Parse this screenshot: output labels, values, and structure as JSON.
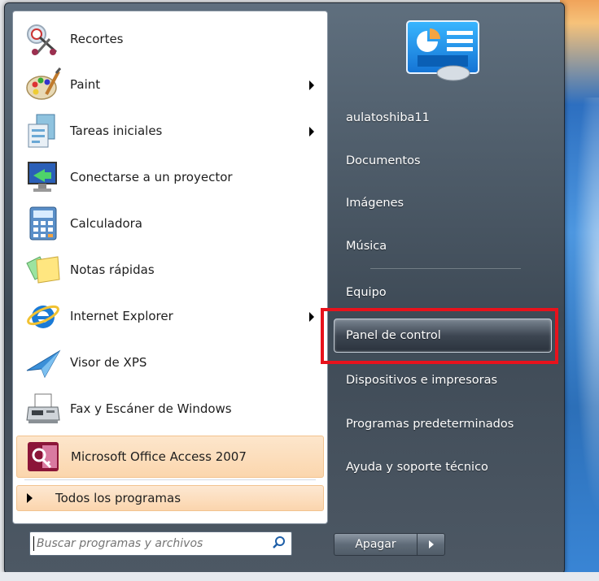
{
  "programs": [
    {
      "label": "Recortes",
      "icon": "scissors-icon",
      "has_arrow": false
    },
    {
      "label": "Paint",
      "icon": "paint-palette-icon",
      "has_arrow": true
    },
    {
      "label": "Tareas iniciales",
      "icon": "getting-started-icon",
      "has_arrow": true
    },
    {
      "label": "Conectarse a un proyector",
      "icon": "projector-monitor-icon",
      "has_arrow": false
    },
    {
      "label": "Calculadora",
      "icon": "calculator-icon",
      "has_arrow": false
    },
    {
      "label": "Notas rápidas",
      "icon": "sticky-notes-icon",
      "has_arrow": false
    },
    {
      "label": "Internet Explorer",
      "icon": "internet-explorer-icon",
      "has_arrow": true
    },
    {
      "label": "Visor de XPS",
      "icon": "xps-viewer-icon",
      "has_arrow": false
    },
    {
      "label": "Fax y Escáner de Windows",
      "icon": "fax-scanner-icon",
      "has_arrow": false
    }
  ],
  "pinned_program": {
    "label": "Microsoft Office Access 2007",
    "icon": "access-key-icon"
  },
  "all_programs_label": "Todos los programas",
  "search": {
    "placeholder": "Buscar programas y archivos"
  },
  "right_items": [
    {
      "label": "aulatoshiba11"
    },
    {
      "label": "Documentos"
    },
    {
      "label": "Imágenes"
    },
    {
      "label": "Música"
    },
    {
      "label": "Equipo"
    },
    {
      "label": "Panel de control"
    },
    {
      "label": "Dispositivos e impresoras"
    },
    {
      "label": "Programas predeterminados"
    },
    {
      "label": "Ayuda y soporte técnico"
    }
  ],
  "shutdown_label": "Apagar",
  "colors": {
    "highlight": "#e8121c",
    "pinned_bg": "#fbd6ad"
  }
}
